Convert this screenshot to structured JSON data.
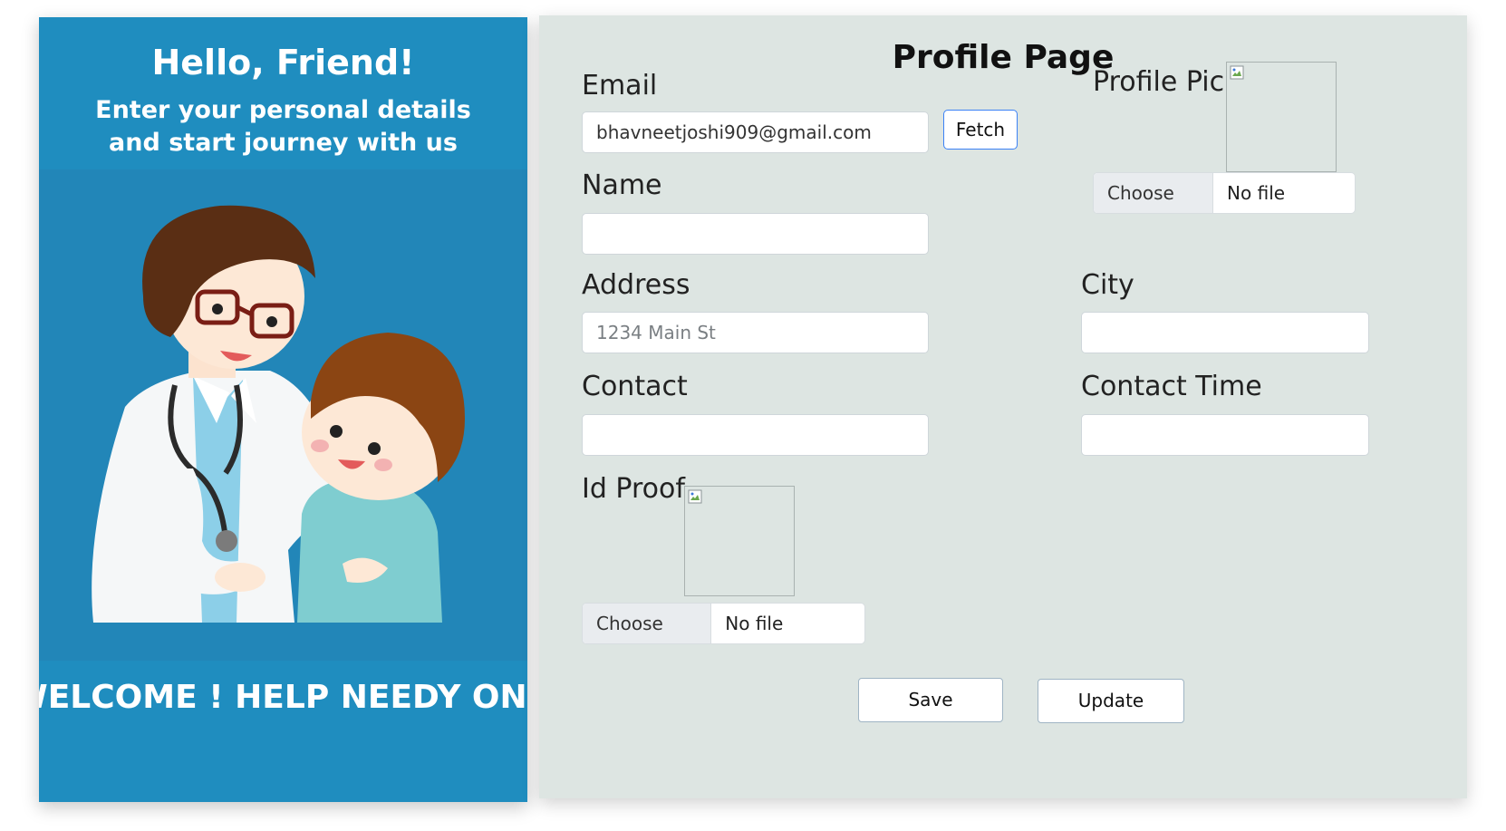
{
  "left": {
    "greeting": "Hello, Friend!",
    "tagline_line1": "Enter your personal details",
    "tagline_line2": "and start journey with us",
    "welcome": "WELCOME ! HELP NEEDY ONE",
    "colors": {
      "panel": "#1f8dbf",
      "illustration_bg": "#2286b8"
    }
  },
  "form": {
    "title": "Profile Page",
    "email": {
      "label": "Email",
      "value": "bhavneetjoshi909@gmail.com"
    },
    "fetch_label": "Fetch",
    "name": {
      "label": "Name",
      "value": ""
    },
    "address": {
      "label": "Address",
      "placeholder": "1234 Main St"
    },
    "city": {
      "label": "City",
      "value": ""
    },
    "contact": {
      "label": "Contact",
      "value": ""
    },
    "contact_time": {
      "label": "Contact Time",
      "value": ""
    },
    "profile_pic": {
      "label": "Profile Pic",
      "choose": "Choose File",
      "status": "No file chosen"
    },
    "id_proof": {
      "label": "Id Proof",
      "choose": "Choose File",
      "status": "No file chosen"
    },
    "save_label": "Save",
    "update_label": "Update",
    "colors": {
      "panel_bg": "#dde5e2",
      "fetch_border": "#3b82f6"
    }
  }
}
